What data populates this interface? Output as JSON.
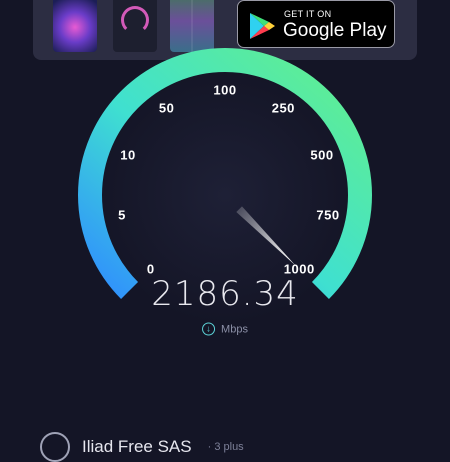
{
  "ad": {
    "store_small": "GET IT ON",
    "store_big": "Google Play"
  },
  "gauge": {
    "ticks": [
      "0",
      "5",
      "10",
      "50",
      "100",
      "250",
      "500",
      "750",
      "1000"
    ],
    "value": "2186.34",
    "unit": "Mbps",
    "colors": {
      "start": "#2f8cff",
      "mid": "#3fe0d0",
      "end": "#64f08a",
      "needle": "#ffffff"
    }
  },
  "provider": {
    "name": "Iliad Free SAS",
    "sub": "· 3 plus"
  }
}
